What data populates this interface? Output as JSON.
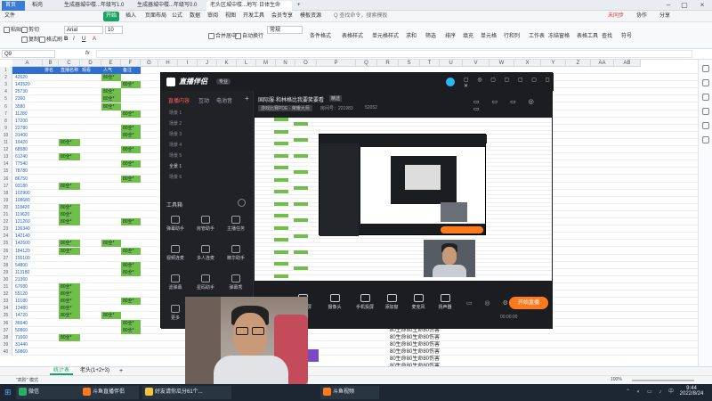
{
  "window_tabs": [
    {
      "label": "首页",
      "active": false,
      "home": true
    },
    {
      "label": "稻壳",
      "active": false
    },
    {
      "label": "生成器城中楼...年级写1.0",
      "active": false
    },
    {
      "label": "生成器城中楼...年级写0.0",
      "active": false
    },
    {
      "label": "老头区城中楼...地写·日体生命",
      "active": true
    }
  ],
  "menu_items": [
    "文件",
    "开始",
    "插入",
    "页面布局",
    "公式",
    "数据",
    "审阅",
    "视图",
    "开发工具",
    "会员专享",
    "模板资源"
  ],
  "menu_search": "Q 查找命令，搜索模板",
  "share_labels": [
    "未同步",
    "协作",
    "分享"
  ],
  "ribbon": {
    "clipboard": [
      "剪切",
      "复制",
      "格式刷"
    ],
    "paste": "粘贴",
    "font_name": "Arial",
    "font_size": "10",
    "wrap": "合并居中",
    "auto_wrap": "自动换行",
    "number_format": "常规",
    "groups": [
      "条件格式",
      "表格样式",
      "单元格样式",
      "求和",
      "筛选",
      "排序",
      "填充",
      "单元格",
      "行和列",
      "工作表",
      "冻结窗格",
      "表格工具",
      "查找",
      "符号"
    ]
  },
  "formula_bar": {
    "cell_ref": "Q9",
    "fx": "fx"
  },
  "columns": [
    "A",
    "B",
    "C",
    "D",
    "E",
    "F",
    "G",
    "H",
    "I",
    "J",
    "K",
    "L",
    "M",
    "N",
    "O",
    "P",
    "Q",
    "R",
    "S",
    "T",
    "U",
    "V",
    "W",
    "X",
    "Y",
    "Z",
    "AA",
    "AB"
  ],
  "header_row": [
    "",
    "排名",
    "直播名称",
    "观看",
    "人气",
    "备注"
  ],
  "rows": [
    {
      "n": "2",
      "a": "42620",
      "c": "",
      "e": "80全*",
      "f": ""
    },
    {
      "n": "3",
      "a": "143520",
      "c": "",
      "e": "",
      "f": "80全*"
    },
    {
      "n": "4",
      "a": "25730",
      "c": "",
      "e": "80全*",
      "f": ""
    },
    {
      "n": "5",
      "a": "2360",
      "c": "",
      "e": "80全*",
      "f": ""
    },
    {
      "n": "6",
      "a": "3580",
      "c": "",
      "e": "80全*",
      "f": ""
    },
    {
      "n": "7",
      "a": "11280",
      "c": "",
      "e": "",
      "f": "80全*"
    },
    {
      "n": "8",
      "a": "17200",
      "c": "",
      "e": "",
      "f": ""
    },
    {
      "n": "9",
      "a": "22780",
      "c": "",
      "e": "",
      "f": "80全*"
    },
    {
      "n": "10",
      "a": "31400",
      "c": "",
      "e": "",
      "f": "80全*"
    },
    {
      "n": "11",
      "a": "16420",
      "c": "80全*",
      "e": "",
      "f": ""
    },
    {
      "n": "12",
      "a": "68580",
      "c": "",
      "e": "",
      "f": "80全*"
    },
    {
      "n": "13",
      "a": "61240",
      "c": "80全*",
      "e": "",
      "f": ""
    },
    {
      "n": "14",
      "a": "77540",
      "c": "",
      "e": "",
      "f": "80全*"
    },
    {
      "n": "15",
      "a": "78780",
      "c": "",
      "e": "",
      "f": ""
    },
    {
      "n": "16",
      "a": "86750",
      "c": "",
      "e": "",
      "f": "80全*"
    },
    {
      "n": "17",
      "a": "93180",
      "c": "80全*",
      "e": "",
      "f": ""
    },
    {
      "n": "18",
      "a": "102900",
      "c": "",
      "e": "",
      "f": ""
    },
    {
      "n": "19",
      "a": "108680",
      "c": "",
      "e": "",
      "f": ""
    },
    {
      "n": "20",
      "a": "118420",
      "c": "80全*",
      "e": "",
      "f": ""
    },
    {
      "n": "21",
      "a": "119620",
      "c": "80全*",
      "e": "",
      "f": ""
    },
    {
      "n": "22",
      "a": "121260",
      "c": "80全*",
      "e": "",
      "f": "80全*"
    },
    {
      "n": "23",
      "a": "136340",
      "c": "",
      "e": "",
      "f": ""
    },
    {
      "n": "24",
      "a": "142140",
      "c": "",
      "e": "",
      "f": ""
    },
    {
      "n": "25",
      "a": "142600",
      "c": "80全*",
      "e": "80全*",
      "f": ""
    },
    {
      "n": "26",
      "a": "184120",
      "c": "80全*",
      "e": "",
      "f": "80全*"
    },
    {
      "n": "27",
      "a": "155100",
      "c": "",
      "e": "",
      "f": ""
    },
    {
      "n": "28",
      "a": "54800",
      "c": "",
      "e": "",
      "f": "80全*"
    },
    {
      "n": "29",
      "a": "113180",
      "c": "",
      "e": "",
      "f": "80全*"
    },
    {
      "n": "30",
      "a": "21360",
      "c": "",
      "e": "",
      "f": ""
    },
    {
      "n": "31",
      "a": "67680",
      "c": "80全*",
      "e": "",
      "f": ""
    },
    {
      "n": "32",
      "a": "55120",
      "c": "80全*",
      "e": "",
      "f": ""
    },
    {
      "n": "33",
      "a": "10180",
      "c": "80全*",
      "e": "",
      "f": "80全*"
    },
    {
      "n": "34",
      "a": "13480",
      "c": "80全*",
      "e": "",
      "f": ""
    },
    {
      "n": "35",
      "a": "14720",
      "c": "80全*",
      "e": "80全*",
      "f": ""
    },
    {
      "n": "36",
      "a": "36640",
      "c": "",
      "e": "",
      "f": "80全*"
    },
    {
      "n": "37",
      "a": "50860",
      "c": "",
      "e": "",
      "f": "80全*"
    },
    {
      "n": "38",
      "a": "71660",
      "c": "80全*",
      "e": "",
      "f": ""
    },
    {
      "n": "39",
      "a": "31440",
      "c": "",
      "e": "",
      "f": ""
    },
    {
      "n": "40",
      "a": "50860",
      "c": "",
      "e": "",
      "f": ""
    }
  ],
  "right_text_rows": [
    "80生命80生命80伤害",
    "80生命80生命80伤害",
    "80生命80生命80伤害",
    "80生命80生命80伤害",
    "80生命80生命80伤害",
    "80生命80生命80伤害",
    "80生命80生命80伤害",
    "80生命80生命80伤害",
    "80生命80生命80伤害",
    "80生命80生命80伤害"
  ],
  "sheet_tabs": {
    "active": "统计表",
    "other": "老头(1+2+3)",
    "add": "+"
  },
  "status": {
    "left": "\"高阶\" 模式",
    "zoom": "100%"
  },
  "stream_app": {
    "title": "直播伴侣",
    "badge": "专业",
    "side_tabs": [
      "直播内容",
      "互动",
      "电池音"
    ],
    "scenes": [
      "场景 1",
      "场景 2",
      "场景 3",
      "场景 4",
      "场景 5",
      "全景 1",
      "场景 6"
    ],
    "tool_section": "工具箱",
    "tools": [
      "弹幕助手",
      "房管助手",
      "主播任务",
      "视频连麦",
      "多人连麦",
      "精华助手",
      "滤弹幕",
      "星码助手",
      "弹幕秀",
      "更多"
    ],
    "room_title": "国际服·和林格比我要笑要看",
    "room_tag": "精选",
    "room_sub": "游戏比赛PDE · 荣耀大师",
    "room_id": "房间号：221983",
    "room_hot": "52052",
    "bottom_tools": [
      "高清横屏",
      "摄像头",
      "手机投屏",
      "添加窗",
      "麦克风",
      "扬声器"
    ],
    "timer": "00:00:00",
    "start_label": "开始直播"
  },
  "taskbar": {
    "items": [
      "微信",
      "斗鱼直播伴侣",
      "好友请你瓜分61个...",
      "斗鱼视频"
    ],
    "time": "9:44",
    "date": "2022/8/24"
  }
}
